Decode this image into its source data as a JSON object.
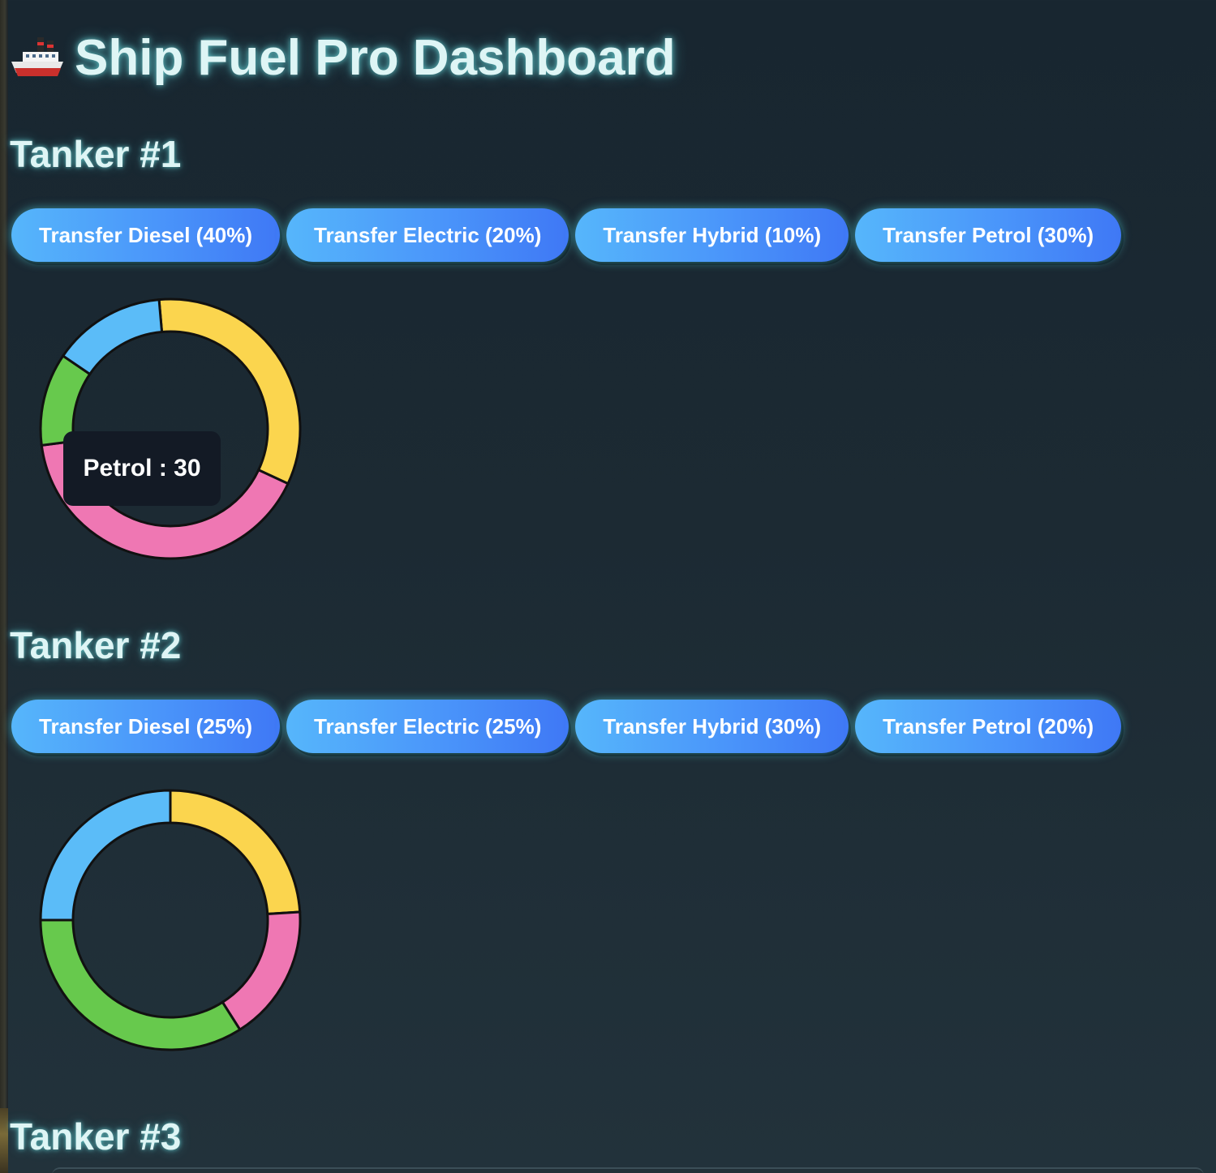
{
  "page": {
    "title": "Ship Fuel Pro Dashboard",
    "title_icon": "ship-icon"
  },
  "colors": {
    "diesel": "#5bbcf8",
    "electric": "#fbd54e",
    "hybrid": "#ef77b3",
    "petrol": "#67c94d",
    "button_gradient_start": "#56b6fb",
    "button_gradient_end": "#3f78f5",
    "glow": "#7af0f0"
  },
  "tankers": [
    {
      "heading": "Tanker #1",
      "buttons": [
        {
          "label": "Transfer Diesel (40%)"
        },
        {
          "label": "Transfer Electric (20%)"
        },
        {
          "label": "Transfer Hybrid (10%)"
        },
        {
          "label": "Transfer Petrol (30%)"
        }
      ],
      "tooltip": "Petrol : 30"
    },
    {
      "heading": "Tanker #2",
      "buttons": [
        {
          "label": "Transfer Diesel (25%)"
        },
        {
          "label": "Transfer Electric (25%)"
        },
        {
          "label": "Transfer Hybrid (30%)"
        },
        {
          "label": "Transfer Petrol (20%)"
        }
      ]
    },
    {
      "heading": "Tanker #3"
    }
  ],
  "chart_data": [
    {
      "type": "pie",
      "variant": "donut",
      "categories": [
        "Electric",
        "Hybrid",
        "Petrol",
        "Diesel"
      ],
      "values": [
        26,
        32,
        9,
        11
      ],
      "start_angle_deg": -5,
      "colors": [
        "#fbd54e",
        "#ef77b3",
        "#67c94d",
        "#5bbcf8"
      ]
    },
    {
      "type": "pie",
      "variant": "donut",
      "categories": [
        "Electric",
        "Hybrid",
        "Petrol",
        "Diesel"
      ],
      "values": [
        24,
        17,
        34,
        25
      ],
      "start_angle_deg": 0,
      "colors": [
        "#fbd54e",
        "#ef77b3",
        "#67c94d",
        "#5bbcf8"
      ]
    }
  ]
}
